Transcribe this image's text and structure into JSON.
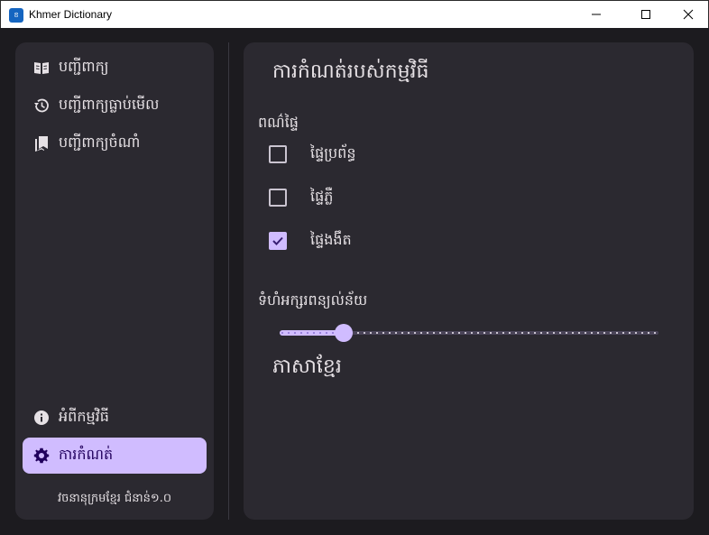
{
  "window": {
    "title": "Khmer Dictionary",
    "icon_text": "ខ"
  },
  "sidebar": {
    "items": [
      {
        "label": "បញ្ជីពាក្យ",
        "icon": "book-open-icon"
      },
      {
        "label": "បញ្ជីពាក្យធ្លាប់មើល",
        "icon": "history-icon"
      },
      {
        "label": "បញ្ជីពាក្យចំណាំ",
        "icon": "bookmarks-icon"
      }
    ],
    "bottom_items": [
      {
        "label": "អំពីកម្មវិធី",
        "icon": "info-icon",
        "active": false
      },
      {
        "label": "ការកំណត់",
        "icon": "gear-icon",
        "active": true
      }
    ],
    "version": "វចនានុក្រមខ្មែរ ជំនាន់១.០"
  },
  "settings": {
    "title": "ការកំណត់របស់កម្មវិធី",
    "theme_label": "ពណ៌ផ្ទៃ",
    "theme_options": [
      {
        "label": "ផ្ទៃប្រព័ន្ធ",
        "checked": false
      },
      {
        "label": "ផ្ទៃភ្លឺ",
        "checked": false
      },
      {
        "label": "ផ្ទៃងងឹត",
        "checked": true
      }
    ],
    "font_size_label": "ទំហំអក្សរពន្យល់ន័យ",
    "font_size_slider": {
      "value_fraction": 0.17
    },
    "preview_text": "ភាសាខ្មែរ"
  },
  "colors": {
    "accent": "#d0bcff",
    "surface": "#2b2930",
    "background": "#1c1b1f",
    "on_surface": "#e6e1e5"
  }
}
